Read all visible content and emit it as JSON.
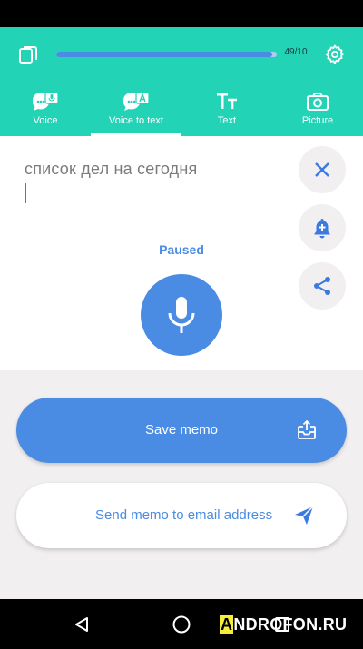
{
  "header": {
    "progress_fraction": 0.98,
    "counter": "49/10"
  },
  "tabs": [
    {
      "label": "Voice",
      "icon": "voice-icon",
      "active": false
    },
    {
      "label": "Voice to text",
      "icon": "voice-to-text-icon",
      "active": true
    },
    {
      "label": "Text",
      "icon": "text-icon",
      "active": false
    },
    {
      "label": "Picture",
      "icon": "camera-icon",
      "active": false
    }
  ],
  "editor": {
    "memo_text": "список дел на сегодня",
    "status": "Paused"
  },
  "actions": {
    "save_label": "Save memo",
    "email_label": "Send memo to email address"
  },
  "watermark": {
    "highlight": "A",
    "rest": "NDROFON.RU"
  },
  "colors": {
    "header": "#22d3b6",
    "accent": "#4a8be3",
    "background": "#f1eff0"
  }
}
